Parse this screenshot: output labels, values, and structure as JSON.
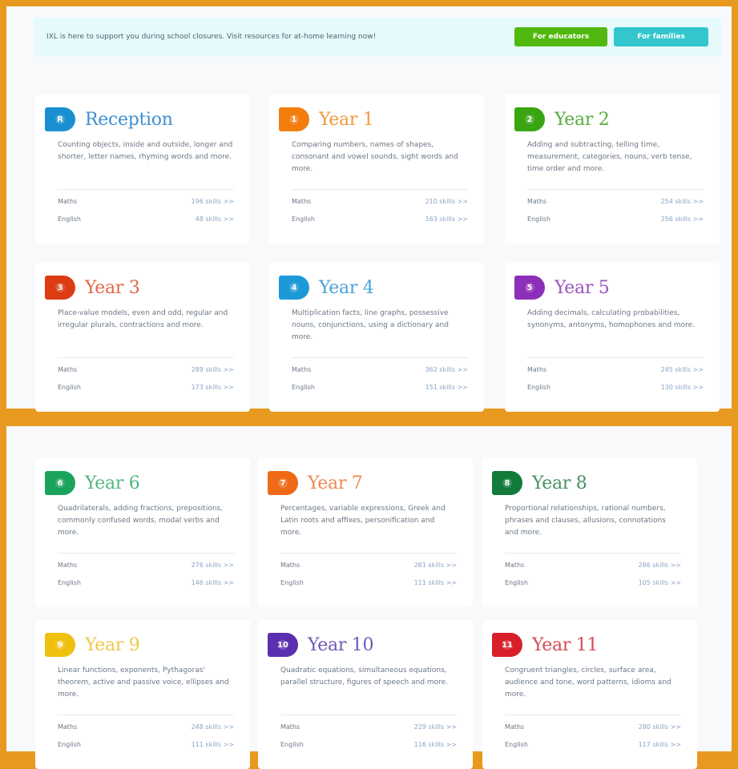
{
  "banner": {
    "text": "IXL is here to support you during school closures. Visit resources for at-home learning now!",
    "educators_label": "For educators",
    "families_label": "For families"
  },
  "cards": [
    {
      "title": "Reception",
      "badge": "R",
      "color": "#1a8fd1",
      "title_color": "#3f8fd0",
      "desc": "Counting objects, inside and outside, longer and shorter, letter names, rhyming words and more.",
      "subjects": [
        {
          "name": "Maths",
          "skills": "196 skills >>"
        },
        {
          "name": "English",
          "skills": "48 skills >>"
        }
      ]
    },
    {
      "title": "Year 1",
      "badge": "1",
      "color": "#f27d0c",
      "title_color": "#f2993a",
      "desc": "Comparing numbers, names of shapes, consonant and vowel sounds, sight words and more.",
      "subjects": [
        {
          "name": "Maths",
          "skills": "210 skills >>"
        },
        {
          "name": "English",
          "skills": "163 skills >>"
        }
      ]
    },
    {
      "title": "Year 2",
      "badge": "2",
      "color": "#3aa512",
      "title_color": "#58ad3c",
      "desc": "Adding and subtracting, telling time, measurement, categories, nouns, verb tense, time order and more.",
      "subjects": [
        {
          "name": "Maths",
          "skills": "254 skills >>"
        },
        {
          "name": "English",
          "skills": "256 skills >>"
        }
      ]
    },
    {
      "title": "Year 3",
      "badge": "3",
      "color": "#dc3c12",
      "title_color": "#e4644a",
      "desc": "Place-value models, even and odd, regular and irregular plurals, contractions and more.",
      "subjects": [
        {
          "name": "Maths",
          "skills": "289 skills >>"
        },
        {
          "name": "English",
          "skills": "173 skills >>"
        }
      ]
    },
    {
      "title": "Year 4",
      "badge": "4",
      "color": "#1c9ad8",
      "title_color": "#4aa1da",
      "desc": "Multiplication facts, line graphs, possessive nouns, conjunctions, using a dictionary and more.",
      "subjects": [
        {
          "name": "Maths",
          "skills": "362 skills >>"
        },
        {
          "name": "English",
          "skills": "151 skills >>"
        }
      ]
    },
    {
      "title": "Year 5",
      "badge": "5",
      "color": "#8b2fb8",
      "title_color": "#9b54c1",
      "desc": "Adding decimals, calculating probabilities, synonyms, antonyms, homophones and more.",
      "subjects": [
        {
          "name": "Maths",
          "skills": "245 skills >>"
        },
        {
          "name": "English",
          "skills": "130 skills >>"
        }
      ]
    },
    {
      "title": "Year 6",
      "badge": "6",
      "color": "#1aa35a",
      "title_color": "#4fb87d",
      "desc": "Quadrilaterals, adding fractions, prepositions, commonly confused words, modal verbs and more.",
      "subjects": [
        {
          "name": "Maths",
          "skills": "276 skills >>"
        },
        {
          "name": "English",
          "skills": "146 skills >>"
        }
      ]
    },
    {
      "title": "Year 7",
      "badge": "7",
      "color": "#ee6a17",
      "title_color": "#ef8850",
      "desc": "Percentages, variable expressions, Greek and Latin roots and affixes, personification and more.",
      "subjects": [
        {
          "name": "Maths",
          "skills": "281 skills >>"
        },
        {
          "name": "English",
          "skills": "111 skills >>"
        }
      ]
    },
    {
      "title": "Year 8",
      "badge": "8",
      "color": "#127a3a",
      "title_color": "#4a8e65",
      "desc": "Proportional relationships, rational numbers, phrases and clauses, allusions, connotations and more.",
      "subjects": [
        {
          "name": "Maths",
          "skills": "286 skills >>"
        },
        {
          "name": "English",
          "skills": "105 skills >>"
        }
      ]
    },
    {
      "title": "Year 9",
      "badge": "9",
      "color": "#f0c010",
      "title_color": "#f0c84a",
      "desc": "Linear functions, exponents, Pythagoras' theorem, active and passive voice, ellipses and more.",
      "subjects": [
        {
          "name": "Maths",
          "skills": "248 skills >>"
        },
        {
          "name": "English",
          "skills": "111 skills >>"
        }
      ]
    },
    {
      "title": "Year 10",
      "badge": "10",
      "color": "#5a2fb0",
      "title_color": "#6f58b8",
      "desc": "Quadratic equations, simultaneous equations, parallel structure, figures of speech and more.",
      "subjects": [
        {
          "name": "Maths",
          "skills": "229 skills >>"
        },
        {
          "name": "English",
          "skills": "116 skills >>"
        }
      ]
    },
    {
      "title": "Year 11",
      "badge": "11",
      "color": "#d81f2a",
      "title_color": "#d44a55",
      "desc": "Congruent triangles, circles, surface area, audience and tone, word patterns, idioms and more.",
      "subjects": [
        {
          "name": "Maths",
          "skills": "280 skills >>"
        },
        {
          "name": "English",
          "skills": "117 skills >>"
        }
      ]
    }
  ]
}
